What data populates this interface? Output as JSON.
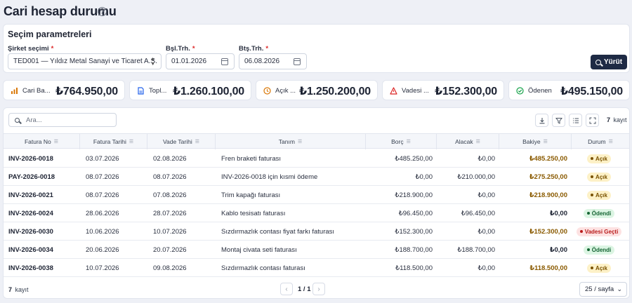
{
  "header": {
    "title": "Cari hesap durumu",
    "help_glyph": "?"
  },
  "params": {
    "title": "Seçim parametreleri",
    "company_label": "Şirket seçimi",
    "company_value": "TED001 — Yıldız Metal Sanayi ve Ticaret A.Ş.",
    "start_label": "Bşl.Trh.",
    "start_value": "01.01.2026",
    "end_label": "Btş.Trh.",
    "end_value": "06.08.2026",
    "required_mark": "*",
    "run_label": "Yürüt"
  },
  "stats": [
    {
      "label": "Cari Ba...",
      "value": "₺764.950,00",
      "icon": "bar-chart-icon",
      "color": "#d97706"
    },
    {
      "label": "Topl...",
      "value": "₺1.260.100,00",
      "icon": "document-icon",
      "color": "#2563eb"
    },
    {
      "label": "Açık ...",
      "value": "₺1.250.200,00",
      "icon": "clock-icon",
      "color": "#d97706"
    },
    {
      "label": "Vadesi ...",
      "value": "₺152.300,00",
      "icon": "warning-icon",
      "color": "#dc2626"
    },
    {
      "label": "Ödenen",
      "value": "₺495.150,00",
      "icon": "check-circle-icon",
      "color": "#16a34a"
    }
  ],
  "toolbar": {
    "search_placeholder": "Ara...",
    "count": "7",
    "count_suffix": "kayıt"
  },
  "columns": [
    "Fatura No",
    "Fatura Tarihi",
    "Vade Tarihi",
    "Tanım",
    "Borç",
    "Alacak",
    "Bakiye",
    "Durum"
  ],
  "rows": [
    {
      "no": "INV-2026-0018",
      "ft": "03.07.2026",
      "vt": "02.08.2026",
      "tanim": "Fren braketi faturası",
      "borc": "₺485.250,00",
      "alacak": "₺0,00",
      "bakiye": "₺485.250,00",
      "durum": "Açık",
      "status": "acik"
    },
    {
      "no": "PAY-2026-0018",
      "ft": "08.07.2026",
      "vt": "08.07.2026",
      "tanim": "INV-2026-0018 için kısmi ödeme",
      "borc": "₺0,00",
      "alacak": "₺210.000,00",
      "bakiye": "₺275.250,00",
      "durum": "Açık",
      "status": "acik"
    },
    {
      "no": "INV-2026-0021",
      "ft": "08.07.2026",
      "vt": "07.08.2026",
      "tanim": "Trim kapağı faturası",
      "borc": "₺218.900,00",
      "alacak": "₺0,00",
      "bakiye": "₺218.900,00",
      "durum": "Açık",
      "status": "acik"
    },
    {
      "no": "INV-2026-0024",
      "ft": "28.06.2026",
      "vt": "28.07.2026",
      "tanim": "Kablo tesisatı faturası",
      "borc": "₺96.450,00",
      "alacak": "₺96.450,00",
      "bakiye": "₺0,00",
      "durum": "Ödendi",
      "status": "odendi"
    },
    {
      "no": "INV-2026-0030",
      "ft": "10.06.2026",
      "vt": "10.07.2026",
      "tanim": "Sızdırmazlık contası fiyat farkı faturası",
      "borc": "₺152.300,00",
      "alacak": "₺0,00",
      "bakiye": "₺152.300,00",
      "durum": "Vadesi Geçti",
      "status": "vade"
    },
    {
      "no": "INV-2026-0034",
      "ft": "20.06.2026",
      "vt": "20.07.2026",
      "tanim": "Montaj civata seti faturası",
      "borc": "₺188.700,00",
      "alacak": "₺188.700,00",
      "bakiye": "₺0,00",
      "durum": "Ödendi",
      "status": "odendi"
    },
    {
      "no": "INV-2026-0038",
      "ft": "10.07.2026",
      "vt": "09.08.2026",
      "tanim": "Sızdırmazlık contası faturası",
      "borc": "₺118.500,00",
      "alacak": "₺0,00",
      "bakiye": "₺118.500,00",
      "durum": "Açık",
      "status": "acik"
    }
  ],
  "footer": {
    "count": "7",
    "count_suffix": "kayıt",
    "page_info": "1 / 1",
    "page_size": "25 / sayfa"
  },
  "colors": {
    "balance_open": "#8a5a00",
    "balance_zero": "#1d2333"
  }
}
